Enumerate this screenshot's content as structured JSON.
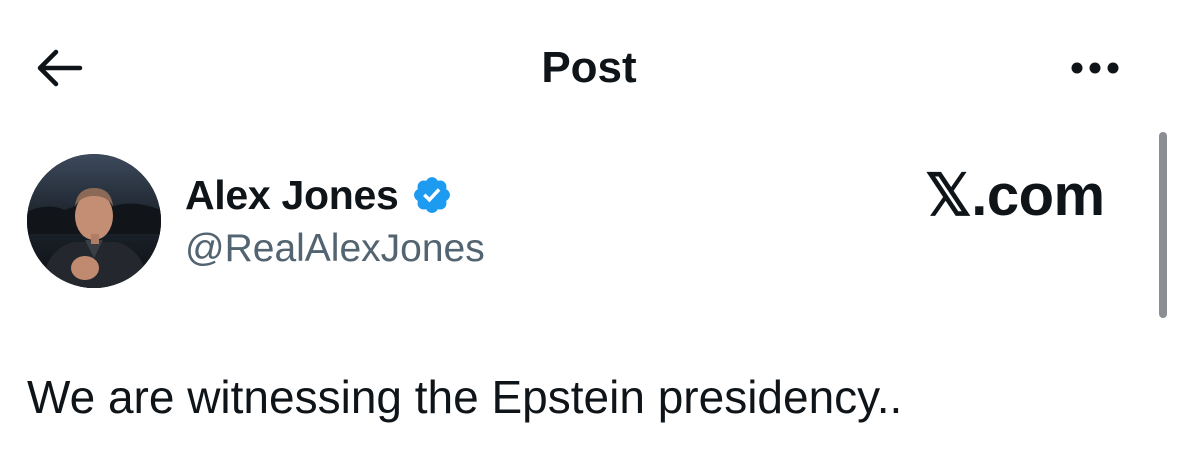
{
  "header": {
    "title": "Post",
    "back_icon": "arrow-left-icon",
    "more_icon": "ellipsis-horizontal-icon"
  },
  "author": {
    "display_name": "Alex Jones",
    "handle": "@RealAlexJones",
    "verified": true,
    "verified_color": "#1d9bf0",
    "avatar_icon": "avatar-photo"
  },
  "watermark": {
    "text": "𝕏.com"
  },
  "tweet": {
    "text": "We are witnessing the Epstein presidency.."
  },
  "colors": {
    "text_primary": "#0f1419",
    "text_secondary": "#536471",
    "accent": "#1d9bf0"
  }
}
